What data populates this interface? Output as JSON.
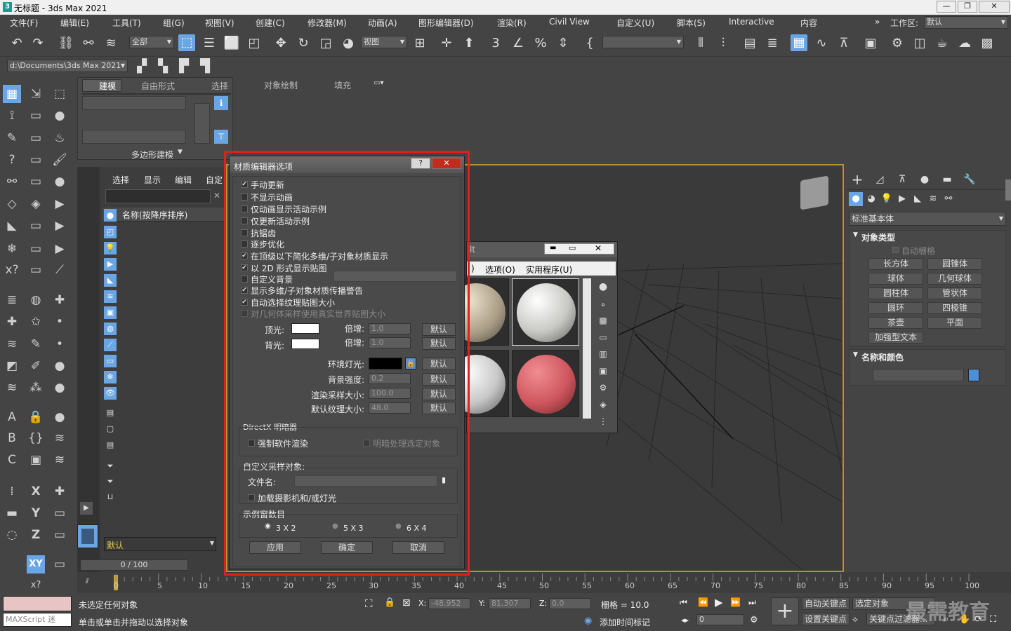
{
  "window": {
    "title": "无标题 - 3ds Max 2021",
    "minimize": "—",
    "maximize": "❐",
    "close": "✕"
  },
  "menubar": {
    "items": [
      "文件(F)",
      "编辑(E)",
      "工具(T)",
      "组(G)",
      "视图(V)",
      "创建(C)",
      "修改器(M)",
      "动画(A)",
      "图形编辑器(D)",
      "渲染(R)",
      "Civil View",
      "自定义(U)",
      "脚本(S)",
      "Interactive",
      "内容"
    ],
    "overflow": "»",
    "workspace_label": "工作区:",
    "workspace_value": "默认"
  },
  "toolbar": {
    "selection_filter": "全部",
    "ref_coord": "视图",
    "named_sel": ""
  },
  "projectbar": {
    "path": "d:\\Documents\\3ds Max 2021"
  },
  "ribbon": {
    "tabs": [
      "建模",
      "自由形式",
      "选择",
      "对象绘制",
      "填充"
    ],
    "panel_label": "多边形建模"
  },
  "explorer": {
    "tabs": [
      "选择",
      "显示",
      "编辑",
      "自定"
    ],
    "column_header": "名称(按降序排序)",
    "layer_value": "默认",
    "frame_counter": "0 / 100"
  },
  "dialog": {
    "title": "材质编辑器选项",
    "help": "?",
    "close": "✕",
    "checkboxes": [
      {
        "label": "手动更新",
        "checked": "✔"
      },
      {
        "label": "不显示动画",
        "checked": ""
      },
      {
        "label": "仅动画显示活动示例",
        "checked": ""
      },
      {
        "label": "仅更新活动示例",
        "checked": ""
      },
      {
        "label": "抗锯齿",
        "checked": ""
      },
      {
        "label": "逐步优化",
        "checked": ""
      },
      {
        "label": "在顶级以下简化多维/子对象材质显示",
        "checked": "✔"
      },
      {
        "label": "以 2D 形式显示贴图",
        "checked": "✔"
      },
      {
        "label": "自定义背景",
        "checked": ""
      },
      {
        "label": "显示多维/子对象材质传播警告",
        "checked": "✔"
      },
      {
        "label": "自动选择纹理贴图大小",
        "checked": "✔"
      },
      {
        "label": "对几何体采样使用真实世界贴图大小",
        "checked": ""
      }
    ],
    "top_light_label": "顶光:",
    "back_light_label": "背光:",
    "multiplier_label": "倍增:",
    "top_mult": "1.0",
    "back_mult": "1.0",
    "default_btn": "默认",
    "ambient_label": "环境灯光:",
    "bg_intensity_label": "背景强度:",
    "bg_intensity": "0.2",
    "render_size_label": "渲染采样大小:",
    "render_size": "100.0",
    "texture_size_label": "默认纹理大小:",
    "texture_size": "48.0",
    "directx_title": "DirectX 明暗器",
    "force_software": "强制软件渲染",
    "shade_selected": "明暗处理选定对象",
    "custom_sample_title": "自定义采样对象:",
    "filename_label": "文件名:",
    "load_camera": "加载摄影机和/或灯光",
    "slots_title": "示例窗数目",
    "slots": [
      "3 X 2",
      "5 X 3",
      "6 X 4"
    ],
    "apply": "应用",
    "ok": "确定",
    "cancel": "取消"
  },
  "mated": {
    "title_fragment": "lt",
    "menu": [
      ")",
      "选项(O)",
      "实用程序(U)"
    ],
    "min": "▬",
    "max": "▭",
    "close": "✕"
  },
  "cmdpanel": {
    "category": "标准基本体",
    "rollout_objtype": "对象类型",
    "autogrid": "自动栅格",
    "buttons": [
      "长方体",
      "圆锥体",
      "球体",
      "几何球体",
      "圆柱体",
      "管状体",
      "圆环",
      "四棱锥",
      "茶壶",
      "平面",
      "加强型文本"
    ],
    "rollout_name": "名称和颜色",
    "swatch_color": "#4d8fd6"
  },
  "timeline": {
    "ticks": [
      "0",
      "5",
      "10",
      "15",
      "20",
      "25",
      "30",
      "35",
      "40",
      "45",
      "50",
      "55",
      "60",
      "65",
      "70",
      "75",
      "80",
      "85",
      "90",
      "95",
      "100"
    ]
  },
  "status": {
    "maxscript": "MAXScript 迷",
    "line1": "未选定任何对象",
    "line2": "单击或单击并拖动以选择对象",
    "x_label": "X:",
    "x_val": "-48.952",
    "y_label": "Y:",
    "y_val": "81.307",
    "z_label": "Z:",
    "z_val": "0.0",
    "grid": "栅格 = 10.0",
    "add_time_tag": "添加时间标记",
    "autokey": "自动关键点",
    "selected": "选定对象",
    "setkey": "设置关键点",
    "keyfilter": "关键点过滤器...",
    "frame": "0",
    "watermark": "最需教育"
  },
  "axes": [
    "XY",
    "X",
    "Y",
    "Z",
    "XY"
  ]
}
